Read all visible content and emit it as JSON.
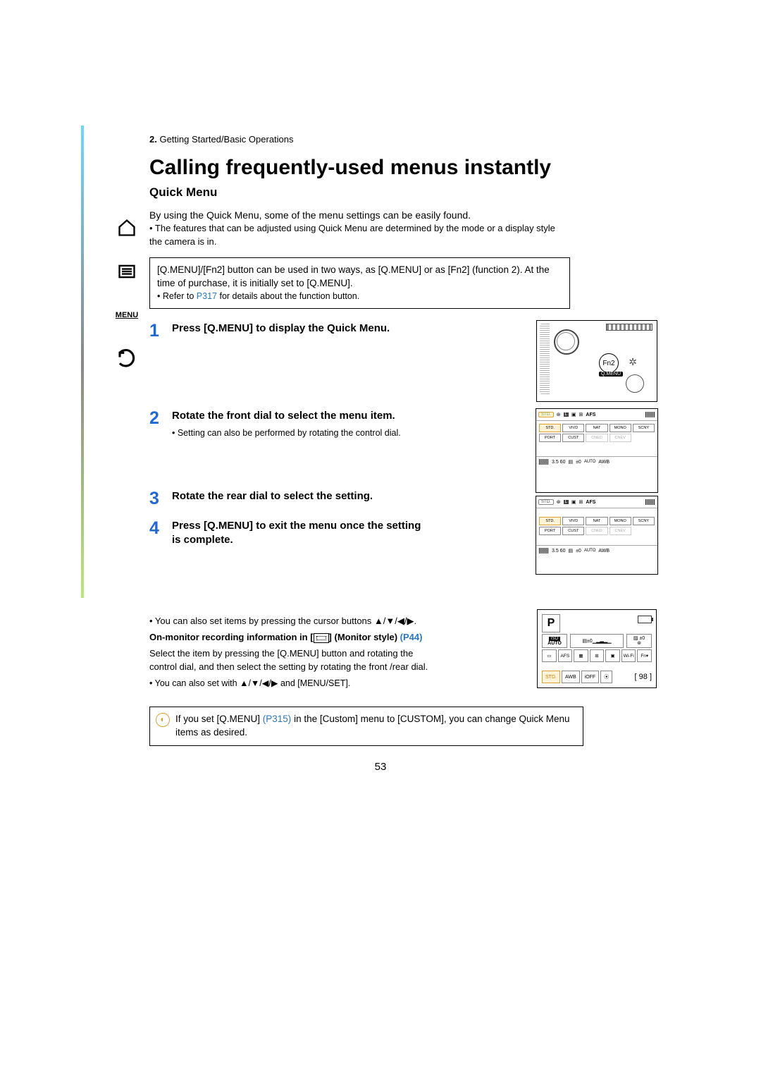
{
  "breadcrumb": {
    "num": "2.",
    "text": "Getting Started/Basic Operations"
  },
  "sidebar": {
    "home": "⌂",
    "list": "☰",
    "menu": "MENU",
    "back": "↶"
  },
  "title": "Calling frequently-used menus instantly",
  "subtitle": "Quick Menu",
  "intro_line": "By using the Quick Menu, some of the menu settings can be easily found.",
  "intro_bullet": "• The features that can be adjusted using Quick Menu are determined by the mode or a display style the camera is in.",
  "info_box": {
    "line1": "[Q.MENU]/[Fn2] button can be used in two ways, as [Q.MENU] or as [Fn2] (function 2). At the time of purchase, it is initially set to [Q.MENU].",
    "ref_prefix": "• Refer to ",
    "ref_link": "P317",
    "ref_suffix": " for details about the function button."
  },
  "steps": {
    "s1": {
      "num": "1",
      "title": "Press [Q.MENU] to display the Quick Menu."
    },
    "s2": {
      "num": "2",
      "title": "Rotate the front dial to select the menu item.",
      "note": "• Setting can also be performed by rotating the control dial."
    },
    "s3": {
      "num": "3",
      "title": "Rotate the rear dial to select the setting."
    },
    "s4": {
      "num": "4",
      "title": "Press [Q.MENU] to exit the menu once the setting is complete."
    }
  },
  "camera_diagram": {
    "fn2": "Fn2",
    "qmenu": "Q.MENU",
    "gear": "✲"
  },
  "screen_top": {
    "hl": "STD.",
    "afs": "AFS",
    "styles": [
      "STD.",
      "VIVD",
      "NAT",
      "MONO",
      "SCNY",
      "PORT",
      "CUST",
      "CNED",
      "CNEV"
    ]
  },
  "screen_bottom": {
    "vals": "3.5  60",
    "ev": "±0",
    "auto": "AUTO",
    "awb": "AWB"
  },
  "after": {
    "bullet1_pre": "• You can also set items by pressing the cursor buttons ",
    "arrows": "▲/▼/◀/▶",
    "bullet1_post": ".",
    "heading_pre": "On-monitor recording information in [",
    "heading_post": "] (Monitor style) ",
    "heading_link": "(P44)",
    "body": "Select the item by pressing the [Q.MENU] button and rotating the control dial, and then select the setting by rotating the front /rear dial.",
    "bullet2_pre": "• You can also set with ",
    "bullet2_post": " and [MENU/SET]."
  },
  "monitor": {
    "p": "P",
    "iso": "ISO",
    "auto": "AUTO",
    "ev": "±0",
    "flash": "±0",
    "row3": [
      "▭",
      "AFS",
      "▦",
      "⊞",
      "▣",
      "Wi-Fi",
      "Fn▾"
    ],
    "std": "STD.",
    "awb": "AWB",
    "ioff": "iOFF",
    "meter": "⦿",
    "bracket": "[",
    "count": "98",
    "bracket2": "]"
  },
  "tip": {
    "pre": "If you set [Q.MENU] ",
    "link": "(P315)",
    "post": " in the [Custom] menu to [CUSTOM], you can change Quick Menu items as desired."
  },
  "page_number": "53"
}
